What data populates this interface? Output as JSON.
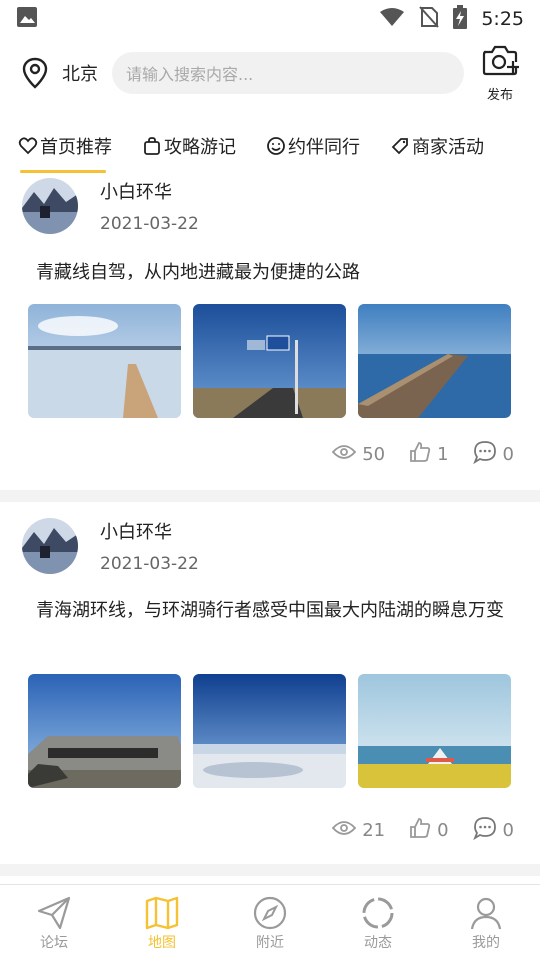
{
  "status_bar": {
    "time": "5:25"
  },
  "header": {
    "city": "北京",
    "search_placeholder": "请输入搜索内容...",
    "publish_label": "发布"
  },
  "tabs": [
    {
      "label": "首页推荐",
      "icon": "heart-icon",
      "active": true
    },
    {
      "label": "攻略游记",
      "icon": "bag-icon"
    },
    {
      "label": "约伴同行",
      "icon": "smile-icon"
    },
    {
      "label": "商家活动",
      "icon": "tag-icon"
    }
  ],
  "posts": [
    {
      "author": "小白环华",
      "date": "2021-03-22",
      "text": "青藏线自驾，从内地进藏最为便捷的公路",
      "views": "50",
      "likes": "1",
      "comments": "0"
    },
    {
      "author": "小白环华",
      "date": "2021-03-22",
      "text": "青海湖环线，与环湖骑行者感受中国最大内陆湖的瞬息万变",
      "views": "21",
      "likes": "0",
      "comments": "0"
    }
  ],
  "bottom_nav": [
    {
      "label": "论坛",
      "icon": "paper-plane-icon"
    },
    {
      "label": "地图",
      "icon": "map-icon",
      "active": true
    },
    {
      "label": "附近",
      "icon": "compass-icon"
    },
    {
      "label": "动态",
      "icon": "loading-ring-icon"
    },
    {
      "label": "我的",
      "icon": "user-icon"
    }
  ],
  "colors": {
    "accent": "#f4c232",
    "muted": "#888888",
    "search_bg": "#f1f1f1"
  }
}
